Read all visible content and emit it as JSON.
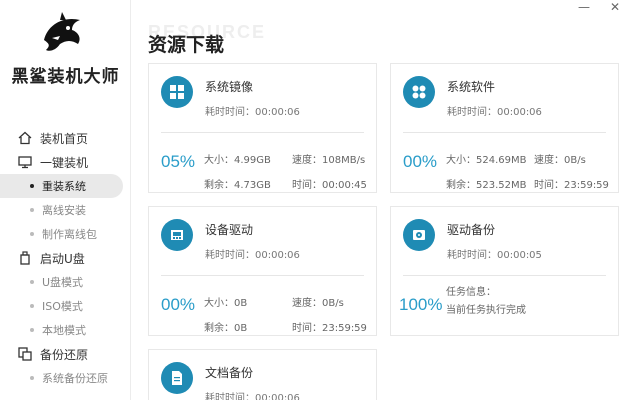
{
  "brand": "黑鲨装机大师",
  "watermark": "RESOURCE",
  "title": "资源下载",
  "window": {
    "minimize": "—",
    "close": "✕"
  },
  "nav": {
    "home": "装机首页",
    "one_key": "一键装机",
    "reinstall": "重装系统",
    "offline_install": "离线安装",
    "make_offline": "制作离线包",
    "usb_boot": "启动U盘",
    "usb_mode": "U盘模式",
    "iso_mode": "ISO模式",
    "local_mode": "本地模式",
    "backup_restore": "备份还原",
    "system_backup": "系统备份还原"
  },
  "cards": {
    "mirror": {
      "name": "系统镜像",
      "time": "耗时时间：00:00:06",
      "percent": "05%",
      "size": "大小：4.99GB",
      "speed": "速度：108MB/s",
      "remain": "剩余：4.73GB",
      "eta": "时间：00:00:45"
    },
    "software": {
      "name": "系统软件",
      "time": "耗时时间：00:00:06",
      "percent": "00%",
      "size": "大小：524.69MB",
      "speed": "速度：0B/s",
      "remain": "剩余：523.52MB",
      "eta": "时间：23:59:59"
    },
    "driver": {
      "name": "设备驱动",
      "time": "耗时时间：00:00:06",
      "percent": "00%",
      "size": "大小：0B",
      "speed": "速度：0B/s",
      "remain": "剩余：0B",
      "eta": "时间：23:59:59"
    },
    "driver_backup": {
      "name": "驱动备份",
      "time": "耗时时间：00:00:05",
      "percent": "100%",
      "task_label": "任务信息：",
      "task_value": "当前任务执行完成"
    },
    "doc_backup": {
      "name": "文档备份",
      "time": "耗时时间：00:00:06"
    }
  },
  "colors": {
    "accent": "#1f8bb4",
    "percent": "#2a9dc9"
  }
}
